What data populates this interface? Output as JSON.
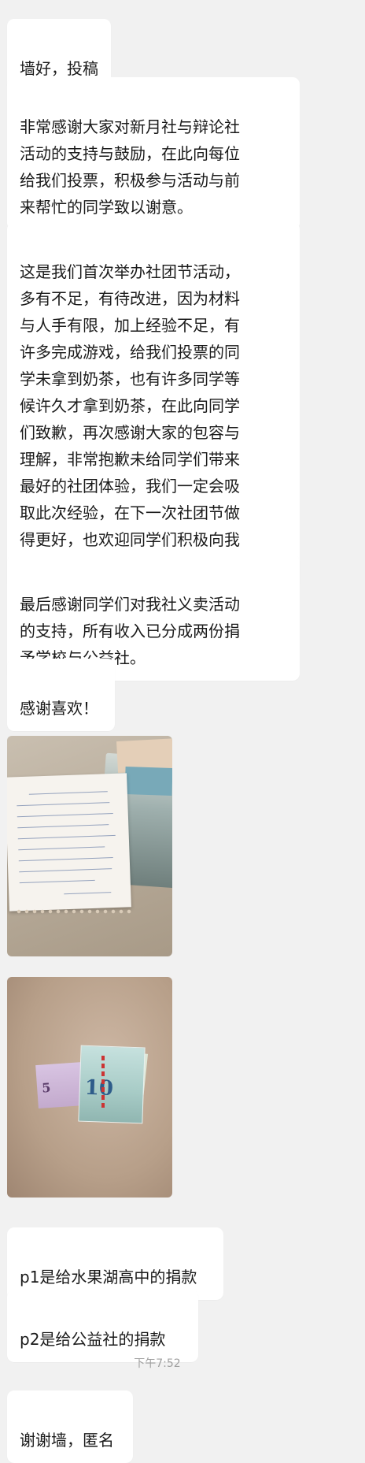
{
  "messages": [
    {
      "type": "text",
      "text": "墙好，投稿"
    },
    {
      "type": "text",
      "text": "非常感谢大家对新月社与辩论社\n活动的支持与鼓励，在此向每位\n给我们投票，积极参与活动与前\n来帮忙的同学致以谢意。"
    },
    {
      "type": "text",
      "text": "这是我们首次举办社团节活动，\n多有不足，有待改进，因为材料\n与人手有限，加上经验不足，有\n许多完成游戏，给我们投票的同\n学未拿到奶茶，也有许多同学等\n候许久才拿到奶茶，在此向同学\n们致歉，再次感谢大家的包容与\n理解，非常抱歉未给同学们带来\n最好的社团体验，我们一定会吸\n取此次经验，在下一次社团节做\n得更好，也欢迎同学们积极向我\n们提出建议。"
    },
    {
      "type": "text",
      "text": "最后感谢同学们对我社义卖活动\n的支持，所有收入已分成两份捐\n予学校与公益社。"
    },
    {
      "type": "text",
      "text": "感谢喜欢！"
    },
    {
      "type": "image",
      "description_icon": "photo-letter-and-cash"
    },
    {
      "type": "image",
      "description_icon": "photo-cash-notes"
    },
    {
      "type": "text",
      "text": "p1是给水果湖高中的捐款"
    },
    {
      "type": "text",
      "text": "p2是给公益社的捐款"
    },
    {
      "type": "text",
      "text": "谢谢墙，匿名"
    }
  ],
  "timestamp": "下午7:52",
  "photo2_text": {
    "ten": "10",
    "five": "5"
  },
  "colors": {
    "background": "#f1f1f1",
    "bubble": "#ffffff",
    "text": "#1a1a1a",
    "timestamp": "#a0a0a0"
  }
}
